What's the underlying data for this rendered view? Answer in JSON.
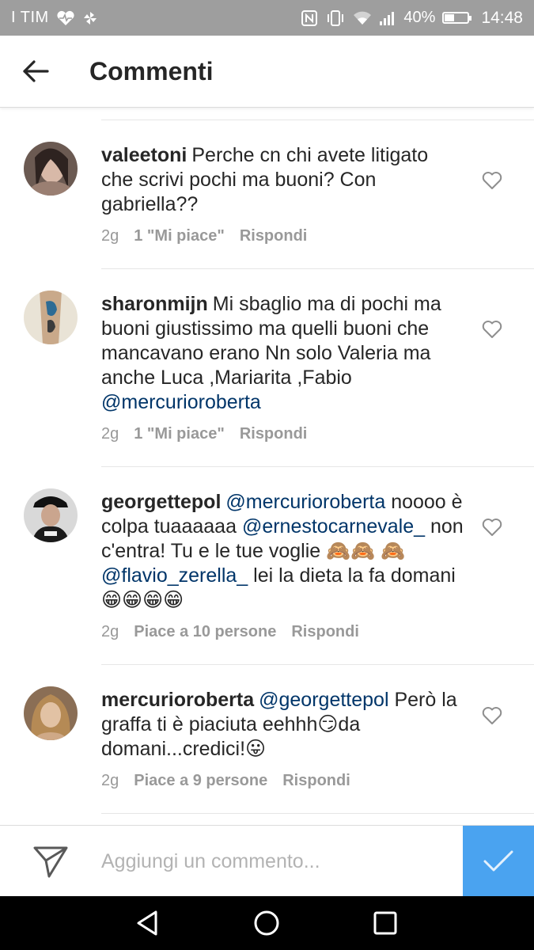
{
  "status_bar": {
    "carrier": "I TIM",
    "battery_text": "40%",
    "battery_level": 0.4,
    "time": "14:48",
    "icons": [
      "heart-pulse-icon",
      "pinwheel-icon",
      "nfc-icon",
      "vibrate-icon",
      "wifi-icon",
      "signal-icon",
      "battery-icon"
    ]
  },
  "header": {
    "title": "Commenti",
    "back_icon": "arrow-left-icon"
  },
  "comments": [
    {
      "username": "valeetoni",
      "parts": [
        {
          "t": "text",
          "v": "Perche cn chi avete litigato che scrivi pochi ma buoni? Con gabriella??"
        }
      ],
      "time": "2g",
      "likes": "1 \"Mi piace\"",
      "reply": "Rispondi"
    },
    {
      "username": "sharonmijn",
      "parts": [
        {
          "t": "text",
          "v": "Mi sbaglio ma di pochi ma buoni giustissimo ma quelli buoni che mancavano erano Nn solo Valeria ma anche Luca ,Mariarita ,Fabio "
        },
        {
          "t": "mention",
          "v": "@mercurioroberta"
        }
      ],
      "time": "2g",
      "likes": "1 \"Mi piace\"",
      "reply": "Rispondi"
    },
    {
      "username": "georgettepol",
      "parts": [
        {
          "t": "mention",
          "v": "@mercurioroberta"
        },
        {
          "t": "text",
          "v": " noooo è colpa tuaaaaaa "
        },
        {
          "t": "mention",
          "v": "@ernestocarnevale_"
        },
        {
          "t": "text",
          "v": " non c'entra!  Tu e le tue voglie 🙈🙈 🙈 "
        },
        {
          "t": "mention",
          "v": "@flavio_zerella_"
        },
        {
          "t": "text",
          "v": " lei la dieta la fa domani 😁😁😁😁"
        }
      ],
      "time": "2g",
      "likes": "Piace a 10 persone",
      "reply": "Rispondi"
    },
    {
      "username": "mercurioroberta",
      "parts": [
        {
          "t": "mention",
          "v": "@georgettepol"
        },
        {
          "t": "text",
          "v": " Però la graffa ti è piaciuta eehhh😏da domani...credici!😛"
        }
      ],
      "time": "2g",
      "likes": "Piace a 9 persone",
      "reply": "Rispondi"
    }
  ],
  "input": {
    "placeholder": "Aggiungi un commento...",
    "send_icon": "paper-plane-icon",
    "post_icon": "checkmark-icon"
  },
  "nav": {
    "icons": [
      "back-triangle-icon",
      "home-circle-icon",
      "recents-square-icon"
    ]
  },
  "colors": {
    "status_bar": "#9e9e9e",
    "mention": "#003569",
    "meta": "#999999",
    "post_button": "#4aa3f0"
  }
}
